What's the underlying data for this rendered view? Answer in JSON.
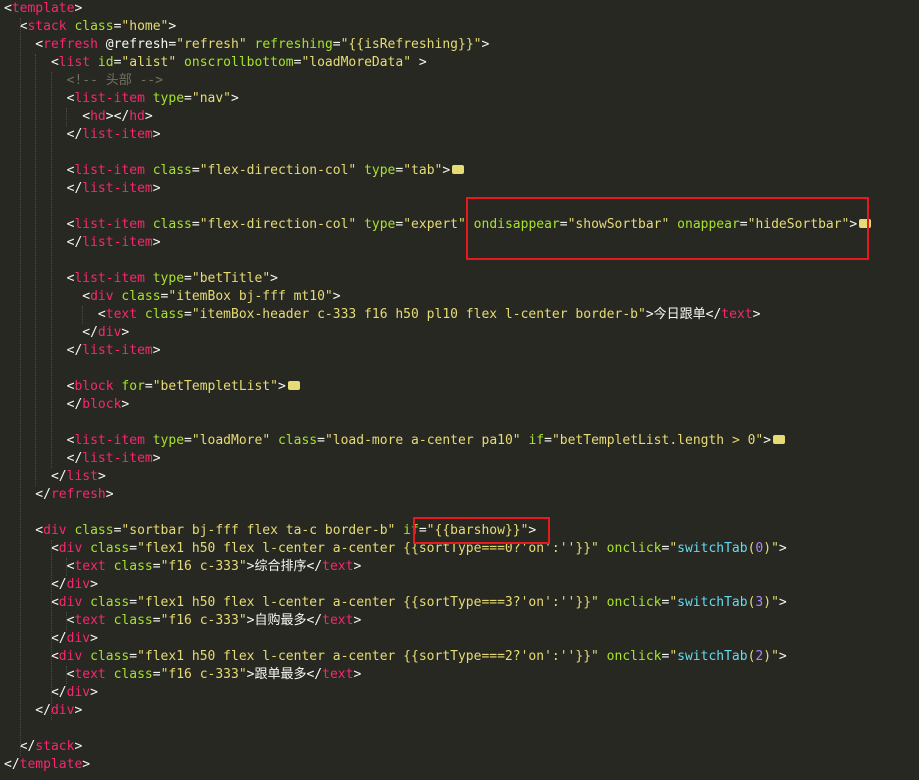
{
  "editor": {
    "lines": [
      [
        {
          "t": "p",
          "v": "<"
        },
        {
          "t": "t",
          "v": "template"
        },
        {
          "t": "p",
          "v": ">"
        }
      ],
      [
        {
          "t": "p",
          "v": "  <"
        },
        {
          "t": "t",
          "v": "stack"
        },
        {
          "t": "a",
          "v": " class"
        },
        {
          "t": "p",
          "v": "="
        },
        {
          "t": "s",
          "v": "\"home\""
        },
        {
          "t": "p",
          "v": ">"
        }
      ],
      [
        {
          "t": "p",
          "v": "    <"
        },
        {
          "t": "t",
          "v": "refresh"
        },
        {
          "t": "p",
          "v": " @refresh="
        },
        {
          "t": "s",
          "v": "\"refresh\""
        },
        {
          "t": "a",
          "v": " refreshing"
        },
        {
          "t": "p",
          "v": "="
        },
        {
          "t": "s",
          "v": "\"{{isRefreshing}}\""
        },
        {
          "t": "p",
          "v": ">"
        }
      ],
      [
        {
          "t": "p",
          "v": "      <"
        },
        {
          "t": "t",
          "v": "list"
        },
        {
          "t": "a",
          "v": " id"
        },
        {
          "t": "p",
          "v": "="
        },
        {
          "t": "s",
          "v": "\"alist\""
        },
        {
          "t": "a",
          "v": " onscrollbottom"
        },
        {
          "t": "p",
          "v": "="
        },
        {
          "t": "s",
          "v": "\"loadMoreData\""
        },
        {
          "t": "p",
          "v": " >"
        }
      ],
      [
        {
          "t": "c",
          "v": "        <!-- 头部 -->"
        }
      ],
      [
        {
          "t": "p",
          "v": "        <"
        },
        {
          "t": "t",
          "v": "list-item"
        },
        {
          "t": "a",
          "v": " type"
        },
        {
          "t": "p",
          "v": "="
        },
        {
          "t": "s",
          "v": "\"nav\""
        },
        {
          "t": "p",
          "v": ">"
        }
      ],
      [
        {
          "t": "p",
          "v": "          <"
        },
        {
          "t": "t",
          "v": "hd"
        },
        {
          "t": "p",
          "v": "></"
        },
        {
          "t": "t",
          "v": "hd"
        },
        {
          "t": "p",
          "v": ">"
        }
      ],
      [
        {
          "t": "p",
          "v": "        </"
        },
        {
          "t": "t",
          "v": "list-item"
        },
        {
          "t": "p",
          "v": ">"
        }
      ],
      [],
      [
        {
          "t": "p",
          "v": "        <"
        },
        {
          "t": "t",
          "v": "list-item"
        },
        {
          "t": "a",
          "v": " class"
        },
        {
          "t": "p",
          "v": "="
        },
        {
          "t": "s",
          "v": "\"flex-direction-col\""
        },
        {
          "t": "a",
          "v": " type"
        },
        {
          "t": "p",
          "v": "="
        },
        {
          "t": "s",
          "v": "\"tab\""
        },
        {
          "t": "p",
          "v": ">"
        },
        {
          "t": "fold",
          "v": ""
        }
      ],
      [
        {
          "t": "p",
          "v": "        </"
        },
        {
          "t": "t",
          "v": "list-item"
        },
        {
          "t": "p",
          "v": ">"
        }
      ],
      [],
      [
        {
          "t": "p",
          "v": "        <"
        },
        {
          "t": "t",
          "v": "list-item"
        },
        {
          "t": "a",
          "v": " class"
        },
        {
          "t": "p",
          "v": "="
        },
        {
          "t": "s",
          "v": "\"flex-direction-col\""
        },
        {
          "t": "a",
          "v": " type"
        },
        {
          "t": "p",
          "v": "="
        },
        {
          "t": "s",
          "v": "\"expert\""
        },
        {
          "t": "a",
          "v": " ondisappear"
        },
        {
          "t": "p",
          "v": "="
        },
        {
          "t": "s",
          "v": "\"showSortbar\""
        },
        {
          "t": "a",
          "v": " onappear"
        },
        {
          "t": "p",
          "v": "="
        },
        {
          "t": "s",
          "v": "\"hideSortbar\""
        },
        {
          "t": "p",
          "v": ">"
        },
        {
          "t": "fold",
          "v": ""
        }
      ],
      [
        {
          "t": "p",
          "v": "        </"
        },
        {
          "t": "t",
          "v": "list-item"
        },
        {
          "t": "p",
          "v": ">"
        }
      ],
      [],
      [
        {
          "t": "p",
          "v": "        <"
        },
        {
          "t": "t",
          "v": "list-item"
        },
        {
          "t": "a",
          "v": " type"
        },
        {
          "t": "p",
          "v": "="
        },
        {
          "t": "s",
          "v": "\"betTitle\""
        },
        {
          "t": "p",
          "v": ">"
        }
      ],
      [
        {
          "t": "p",
          "v": "          <"
        },
        {
          "t": "t",
          "v": "div"
        },
        {
          "t": "a",
          "v": " class"
        },
        {
          "t": "p",
          "v": "="
        },
        {
          "t": "s",
          "v": "\"itemBox bj-fff mt10\""
        },
        {
          "t": "p",
          "v": ">"
        }
      ],
      [
        {
          "t": "p",
          "v": "            <"
        },
        {
          "t": "t",
          "v": "text"
        },
        {
          "t": "a",
          "v": " class"
        },
        {
          "t": "p",
          "v": "="
        },
        {
          "t": "s",
          "v": "\"itemBox-header c-333 f16 h50 pl10 flex l-center border-b\""
        },
        {
          "t": "p",
          "v": ">今日跟单</"
        },
        {
          "t": "t",
          "v": "text"
        },
        {
          "t": "p",
          "v": ">"
        }
      ],
      [
        {
          "t": "p",
          "v": "          </"
        },
        {
          "t": "t",
          "v": "div"
        },
        {
          "t": "p",
          "v": ">"
        }
      ],
      [
        {
          "t": "p",
          "v": "        </"
        },
        {
          "t": "t",
          "v": "list-item"
        },
        {
          "t": "p",
          "v": ">"
        }
      ],
      [],
      [
        {
          "t": "p",
          "v": "        <"
        },
        {
          "t": "t",
          "v": "block"
        },
        {
          "t": "a",
          "v": " for"
        },
        {
          "t": "p",
          "v": "="
        },
        {
          "t": "s",
          "v": "\"betTempletList\""
        },
        {
          "t": "p",
          "v": ">"
        },
        {
          "t": "fold",
          "v": ""
        }
      ],
      [
        {
          "t": "p",
          "v": "        </"
        },
        {
          "t": "t",
          "v": "block"
        },
        {
          "t": "p",
          "v": ">"
        }
      ],
      [],
      [
        {
          "t": "p",
          "v": "        <"
        },
        {
          "t": "t",
          "v": "list-item"
        },
        {
          "t": "a",
          "v": " type"
        },
        {
          "t": "p",
          "v": "="
        },
        {
          "t": "s",
          "v": "\"loadMore\""
        },
        {
          "t": "a",
          "v": " class"
        },
        {
          "t": "p",
          "v": "="
        },
        {
          "t": "s",
          "v": "\"load-more a-center pa10\""
        },
        {
          "t": "a",
          "v": " if"
        },
        {
          "t": "p",
          "v": "="
        },
        {
          "t": "s",
          "v": "\"betTempletList.length > 0\""
        },
        {
          "t": "p",
          "v": ">"
        },
        {
          "t": "fold",
          "v": ""
        }
      ],
      [
        {
          "t": "p",
          "v": "        </"
        },
        {
          "t": "t",
          "v": "list-item"
        },
        {
          "t": "p",
          "v": ">"
        }
      ],
      [
        {
          "t": "p",
          "v": "      </"
        },
        {
          "t": "t",
          "v": "list"
        },
        {
          "t": "p",
          "v": ">"
        }
      ],
      [
        {
          "t": "p",
          "v": "    </"
        },
        {
          "t": "t",
          "v": "refresh"
        },
        {
          "t": "p",
          "v": ">"
        }
      ],
      [],
      [
        {
          "t": "p",
          "v": "    <"
        },
        {
          "t": "t",
          "v": "div"
        },
        {
          "t": "a",
          "v": " class"
        },
        {
          "t": "p",
          "v": "="
        },
        {
          "t": "s",
          "v": "\"sortbar bj-fff flex ta-c border-b\""
        },
        {
          "t": "a",
          "v": " if"
        },
        {
          "t": "p",
          "v": "="
        },
        {
          "t": "s",
          "v": "\"{{barshow}}\""
        },
        {
          "t": "p",
          "v": ">"
        }
      ],
      [
        {
          "t": "p",
          "v": "      <"
        },
        {
          "t": "t",
          "v": "div"
        },
        {
          "t": "a",
          "v": " class"
        },
        {
          "t": "p",
          "v": "="
        },
        {
          "t": "s",
          "v": "\"flex1 h50 flex l-center a-center {{sortType===0?'on':''}}\""
        },
        {
          "t": "a",
          "v": " onclick"
        },
        {
          "t": "p",
          "v": "="
        },
        {
          "t": "s",
          "v": "\""
        },
        {
          "t": "f",
          "v": "switchTab"
        },
        {
          "t": "s",
          "v": "("
        },
        {
          "t": "n",
          "v": "0"
        },
        {
          "t": "s",
          "v": ")\""
        },
        {
          "t": "p",
          "v": ">"
        }
      ],
      [
        {
          "t": "p",
          "v": "        <"
        },
        {
          "t": "t",
          "v": "text"
        },
        {
          "t": "a",
          "v": " class"
        },
        {
          "t": "p",
          "v": "="
        },
        {
          "t": "s",
          "v": "\"f16 c-333\""
        },
        {
          "t": "p",
          "v": ">综合排序</"
        },
        {
          "t": "t",
          "v": "text"
        },
        {
          "t": "p",
          "v": ">"
        }
      ],
      [
        {
          "t": "p",
          "v": "      </"
        },
        {
          "t": "t",
          "v": "div"
        },
        {
          "t": "p",
          "v": ">"
        }
      ],
      [
        {
          "t": "p",
          "v": "      <"
        },
        {
          "t": "t",
          "v": "div"
        },
        {
          "t": "a",
          "v": " class"
        },
        {
          "t": "p",
          "v": "="
        },
        {
          "t": "s",
          "v": "\"flex1 h50 flex l-center a-center {{sortType===3?'on':''}}\""
        },
        {
          "t": "a",
          "v": " onclick"
        },
        {
          "t": "p",
          "v": "="
        },
        {
          "t": "s",
          "v": "\""
        },
        {
          "t": "f",
          "v": "switchTab"
        },
        {
          "t": "s",
          "v": "("
        },
        {
          "t": "n",
          "v": "3"
        },
        {
          "t": "s",
          "v": ")\""
        },
        {
          "t": "p",
          "v": ">"
        }
      ],
      [
        {
          "t": "p",
          "v": "        <"
        },
        {
          "t": "t",
          "v": "text"
        },
        {
          "t": "a",
          "v": " class"
        },
        {
          "t": "p",
          "v": "="
        },
        {
          "t": "s",
          "v": "\"f16 c-333\""
        },
        {
          "t": "p",
          "v": ">自购最多</"
        },
        {
          "t": "t",
          "v": "text"
        },
        {
          "t": "p",
          "v": ">"
        }
      ],
      [
        {
          "t": "p",
          "v": "      </"
        },
        {
          "t": "t",
          "v": "div"
        },
        {
          "t": "p",
          "v": ">"
        }
      ],
      [
        {
          "t": "p",
          "v": "      <"
        },
        {
          "t": "t",
          "v": "div"
        },
        {
          "t": "a",
          "v": " class"
        },
        {
          "t": "p",
          "v": "="
        },
        {
          "t": "s",
          "v": "\"flex1 h50 flex l-center a-center {{sortType===2?'on':''}}\""
        },
        {
          "t": "a",
          "v": " onclick"
        },
        {
          "t": "p",
          "v": "="
        },
        {
          "t": "s",
          "v": "\""
        },
        {
          "t": "f",
          "v": "switchTab"
        },
        {
          "t": "s",
          "v": "("
        },
        {
          "t": "n",
          "v": "2"
        },
        {
          "t": "s",
          "v": ")\""
        },
        {
          "t": "p",
          "v": ">"
        }
      ],
      [
        {
          "t": "p",
          "v": "        <"
        },
        {
          "t": "t",
          "v": "text"
        },
        {
          "t": "a",
          "v": " class"
        },
        {
          "t": "p",
          "v": "="
        },
        {
          "t": "s",
          "v": "\"f16 c-333\""
        },
        {
          "t": "p",
          "v": ">跟单最多</"
        },
        {
          "t": "t",
          "v": "text"
        },
        {
          "t": "p",
          "v": ">"
        }
      ],
      [
        {
          "t": "p",
          "v": "      </"
        },
        {
          "t": "t",
          "v": "div"
        },
        {
          "t": "p",
          "v": ">"
        }
      ],
      [
        {
          "t": "p",
          "v": "    </"
        },
        {
          "t": "t",
          "v": "div"
        },
        {
          "t": "p",
          "v": ">"
        }
      ],
      [],
      [
        {
          "t": "p",
          "v": "  </"
        },
        {
          "t": "t",
          "v": "stack"
        },
        {
          "t": "p",
          "v": ">"
        }
      ],
      [
        {
          "t": "p",
          "v": "</"
        },
        {
          "t": "t",
          "v": "template"
        },
        {
          "t": "p",
          "v": ">"
        }
      ]
    ]
  },
  "highlights": [
    {
      "label": "ondisappear-onappear-highlight"
    },
    {
      "label": "barshow-highlight"
    }
  ],
  "colors": {
    "background": "#272822",
    "tag": "#f92672",
    "attribute": "#a6e22e",
    "string": "#e6db74",
    "comment": "#75715e",
    "function": "#66d9ef",
    "number": "#ae81ff",
    "highlight_box": "#e8191e"
  }
}
